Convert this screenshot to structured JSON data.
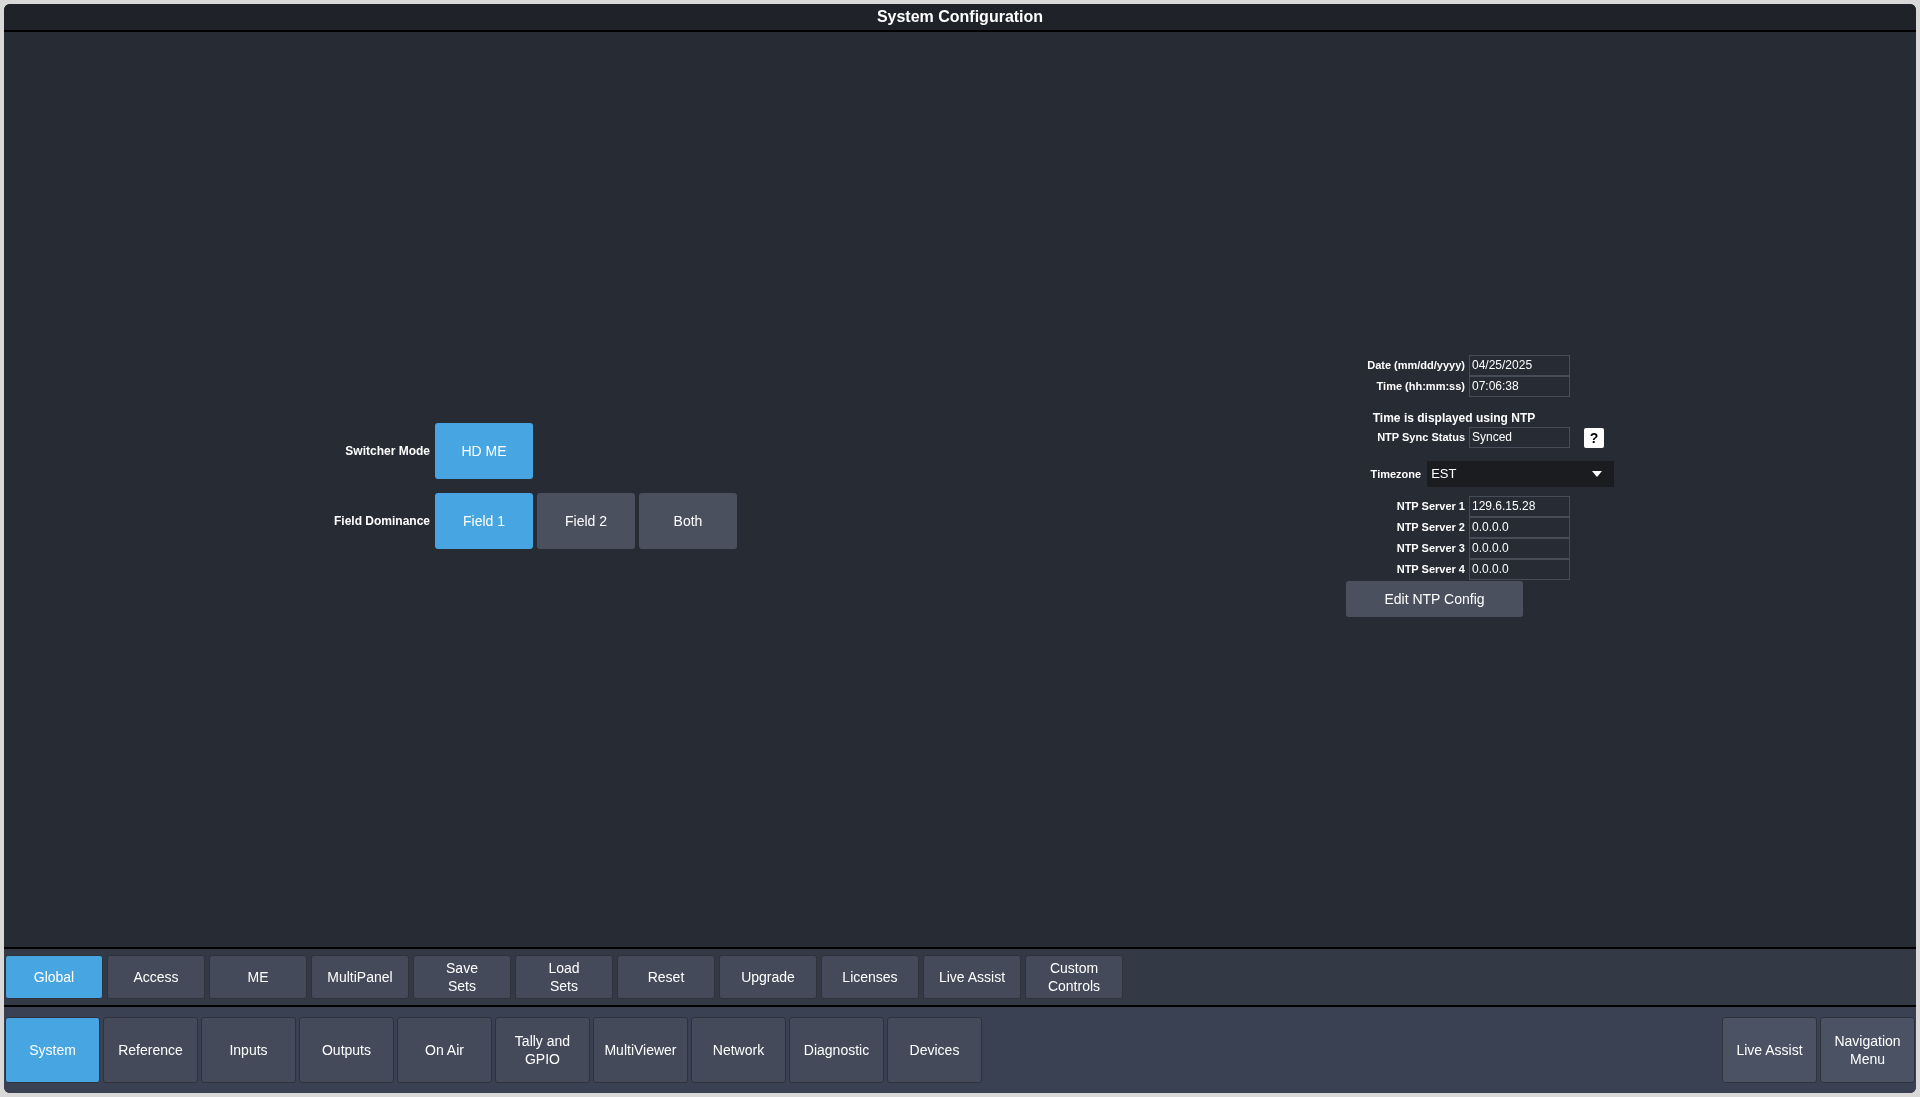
{
  "window": {
    "title": "System Configuration"
  },
  "switcher_mode": {
    "label": "Switcher Mode",
    "options": [
      {
        "label": "HD ME",
        "selected": true
      }
    ]
  },
  "field_dominance": {
    "label": "Field Dominance",
    "options": [
      {
        "label": "Field 1",
        "selected": true
      },
      {
        "label": "Field 2",
        "selected": false
      },
      {
        "label": "Both",
        "selected": false
      }
    ]
  },
  "date_time": [
    {
      "label": "Date (mm/dd/yyyy)",
      "value": "04/25/2025"
    },
    {
      "label": "Time (hh:mm:ss)",
      "value": "07:06:38"
    }
  ],
  "ntp_note": "Time is displayed using NTP",
  "ntp_sync": {
    "label": "NTP Sync Status",
    "value": "Synced",
    "help": "?"
  },
  "timezone": {
    "label": "Timezone",
    "value": "EST"
  },
  "ntp_servers": [
    {
      "label": "NTP Server 1",
      "value": "129.6.15.28"
    },
    {
      "label": "NTP Server 2",
      "value": "0.0.0.0"
    },
    {
      "label": "NTP Server 3",
      "value": "0.0.0.0"
    },
    {
      "label": "NTP Server 4",
      "value": "0.0.0.0"
    }
  ],
  "edit_button": "Edit NTP Config",
  "sub_tabs": [
    {
      "label": "Global",
      "selected": true
    },
    {
      "label": "Access",
      "selected": false
    },
    {
      "label": "ME",
      "selected": false
    },
    {
      "label": "MultiPanel",
      "selected": false
    },
    {
      "label": "Save\nSets",
      "selected": false
    },
    {
      "label": "Load\nSets",
      "selected": false
    },
    {
      "label": "Reset",
      "selected": false
    },
    {
      "label": "Upgrade",
      "selected": false
    },
    {
      "label": "Licenses",
      "selected": false
    },
    {
      "label": "Live Assist",
      "selected": false
    },
    {
      "label": "Custom\nControls",
      "selected": false
    }
  ],
  "main_tabs": [
    {
      "label": "System",
      "selected": true
    },
    {
      "label": "Reference",
      "selected": false
    },
    {
      "label": "Inputs",
      "selected": false
    },
    {
      "label": "Outputs",
      "selected": false
    },
    {
      "label": "On Air",
      "selected": false
    },
    {
      "label": "Tally and\nGPIO",
      "selected": false
    },
    {
      "label": "MultiViewer",
      "selected": false
    },
    {
      "label": "Network",
      "selected": false
    },
    {
      "label": "Diagnostic",
      "selected": false
    },
    {
      "label": "Devices",
      "selected": false
    }
  ],
  "right_buttons": [
    "Live Assist",
    "Navigation\nMenu"
  ]
}
